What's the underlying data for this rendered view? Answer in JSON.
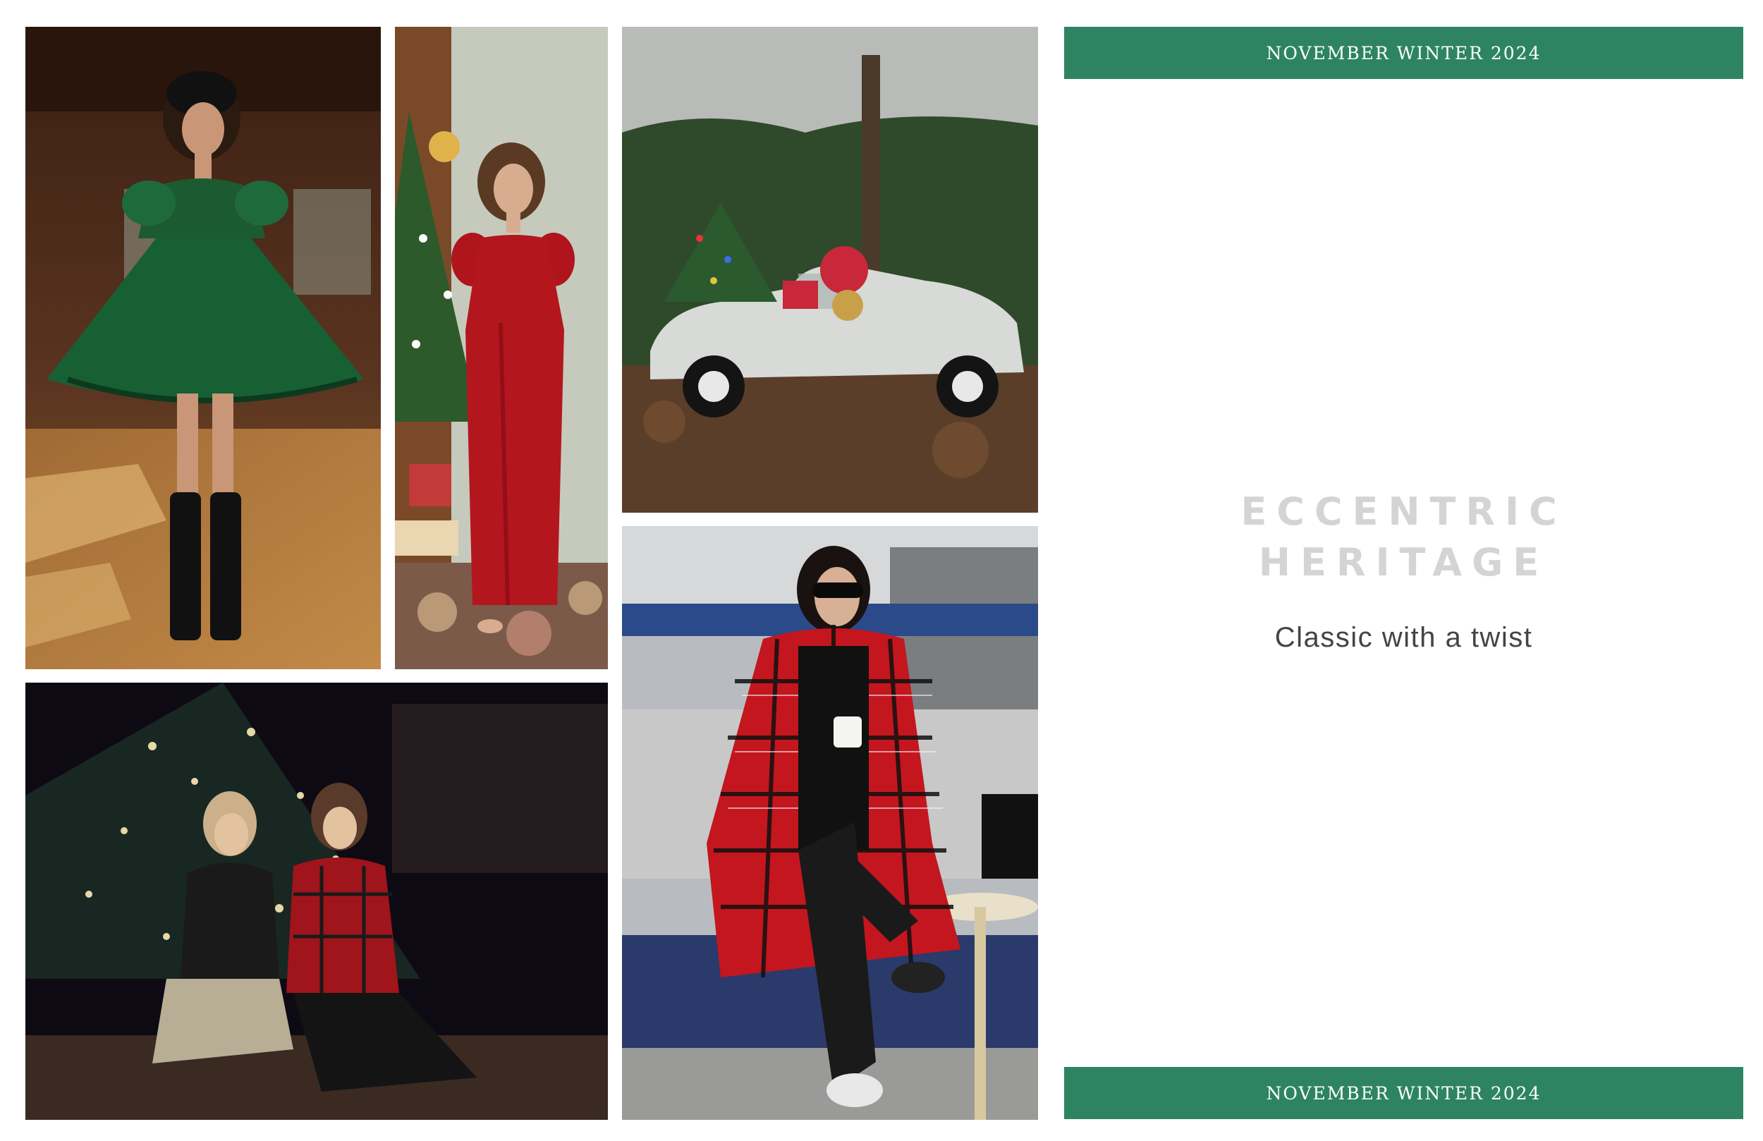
{
  "colors": {
    "accent_green": "#2e8462",
    "title_gray": "#d4d4d4",
    "subtitle_gray": "#444444"
  },
  "banner_top": {
    "text": "NOVEMBER WINTER 2024"
  },
  "banner_bottom": {
    "text": "NOVEMBER WINTER 2024"
  },
  "title": {
    "line1": "ECCENTRIC",
    "line2": "HERITAGE"
  },
  "subtitle": "Classic with a twist"
}
